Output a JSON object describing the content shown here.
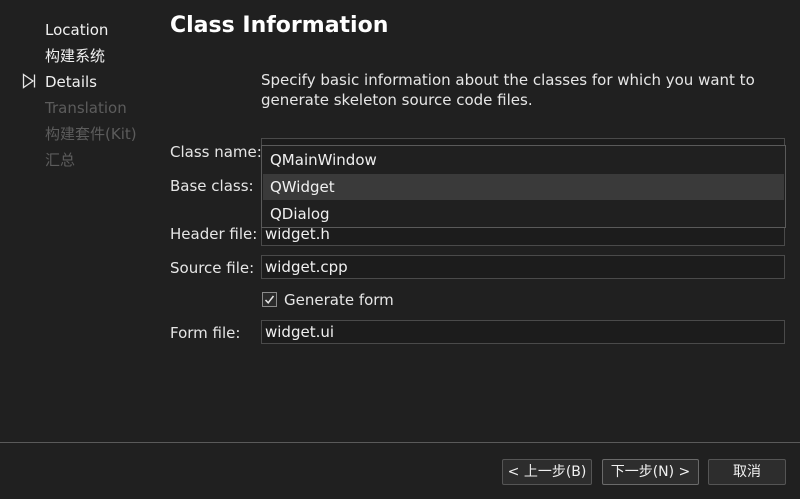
{
  "sidebar": {
    "steps": [
      {
        "label": "Location",
        "state": "done"
      },
      {
        "label": "构建系统",
        "state": "done"
      },
      {
        "label": "Details",
        "state": "current"
      },
      {
        "label": "Translation",
        "state": "future"
      },
      {
        "label": "构建套件(Kit)",
        "state": "future"
      },
      {
        "label": "汇总",
        "state": "future"
      }
    ]
  },
  "main": {
    "title": "Class Information",
    "description": "Specify basic information about the classes for which you want to generate skeleton source code files.",
    "labels": {
      "class_name": "Class name:",
      "base_class": "Base class:",
      "header_file": "Header file:",
      "source_file": "Source file:",
      "form_file": "Form file:"
    },
    "fields": {
      "class_name": "",
      "header_file": "widget.h",
      "source_file": "widget.cpp",
      "form_file": "widget.ui"
    },
    "base_class_options": [
      "QMainWindow",
      "QWidget",
      "QDialog"
    ],
    "base_class_highlighted": "QWidget",
    "generate_form": {
      "label": "Generate form",
      "checked": true
    }
  },
  "footer": {
    "back_label": "< 上一步(B)",
    "next_label": "下一步(N) >",
    "cancel_label": "取消"
  },
  "colors": {
    "background": "#202020",
    "text": "#e6e6e6",
    "disabled_text": "#5c5c5c",
    "highlight": "#3a3a3a"
  }
}
